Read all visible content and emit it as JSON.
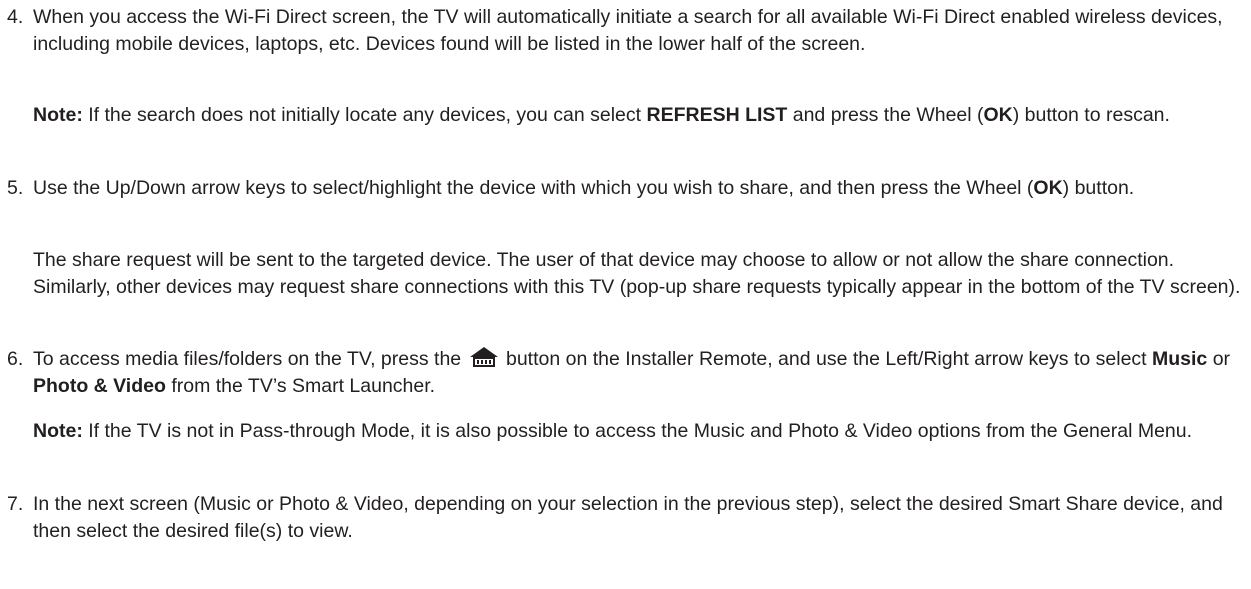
{
  "step4": {
    "number": "4.",
    "text": "When you access the Wi-Fi Direct screen, the TV will automatically initiate a search for all available Wi-Fi Direct enabled wireless devices, including mobile devices, laptops, etc. Devices found will be listed in the lower half of the screen.",
    "note_label": "Note:",
    "note_text_1": " If the search does not initially locate any devices, you can select ",
    "note_bold_1": "REFRESH LIST",
    "note_text_2": " and press the Wheel (",
    "note_bold_2": "OK",
    "note_text_3": ") button to rescan."
  },
  "step5": {
    "number": "5.",
    "text_1": "Use the Up/Down arrow keys to select/highlight the device with which you wish to share, and then press the Wheel (",
    "bold_1": "OK",
    "text_2": ") button.",
    "para_2": "The share request will be sent to the targeted device. The user of that device may choose to allow or not allow the share connection. Similarly, other devices may request share connections with this TV (pop-up share requests typically appear in the bottom of the TV screen)."
  },
  "step6": {
    "number": "6.",
    "text_1": "To access media files/folders on the TV, press the ",
    "icon": "home-icon",
    "text_2": " button on the Installer Remote, and use the Left/Right arrow keys to select ",
    "bold_1": "Music",
    "text_3": " or ",
    "bold_2": "Photo & Video",
    "text_4": " from the TV’s Smart Launcher.",
    "note_label": "Note:",
    "note_text": " If the TV is not in Pass-through Mode, it is also possible to access the Music and Photo & Video options from the General Menu."
  },
  "step7": {
    "number": "7.",
    "text": "In the next screen (Music or Photo & Video, depending on your selection in the previous step), select the desired Smart Share device, and then select the desired file(s) to view."
  }
}
